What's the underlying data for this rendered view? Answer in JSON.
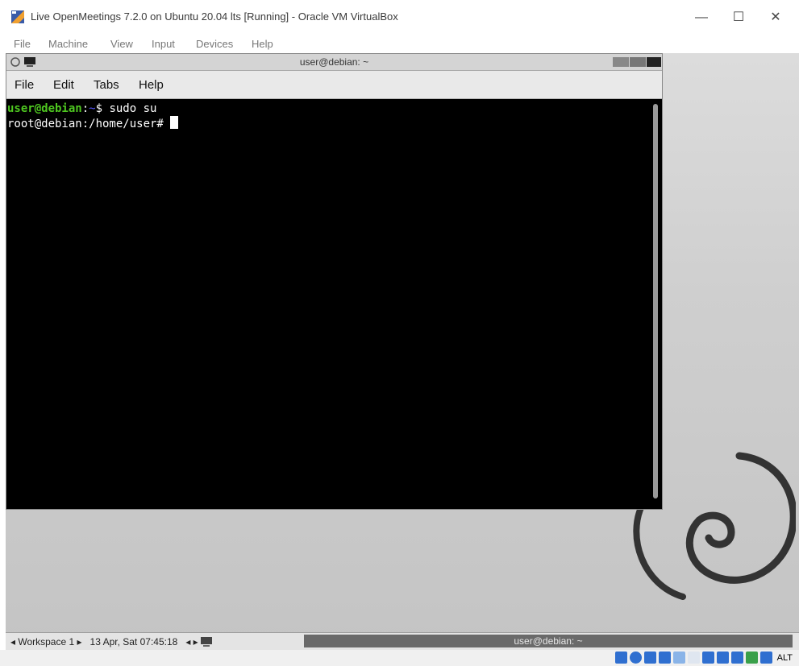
{
  "host_window": {
    "title": "Live OpenMeetings 7.2.0 on Ubuntu 20.04 lts [Running] - Oracle VM VirtualBox",
    "controls": {
      "minimize": "—",
      "maximize": "☐",
      "close": "✕"
    },
    "menu": [
      "File",
      "Machine",
      "View",
      "Input",
      "Devices",
      "Help"
    ]
  },
  "terminal": {
    "title": "user@debian: ~",
    "menu": [
      "File",
      "Edit",
      "Tabs",
      "Help"
    ],
    "lines": {
      "line1_user": "user@debian",
      "line1_colon": ":",
      "line1_path": "~",
      "line1_cmd": "$ sudo su",
      "line2": "root@debian:/home/user# "
    }
  },
  "taskbar": {
    "workspace": "◂ Workspace 1 ▸",
    "datetime": "13 Apr, Sat 07:45:18",
    "arrows": "◂ ▸",
    "active_window": "user@debian: ~"
  },
  "statusbar": {
    "host_key": "ALT"
  }
}
